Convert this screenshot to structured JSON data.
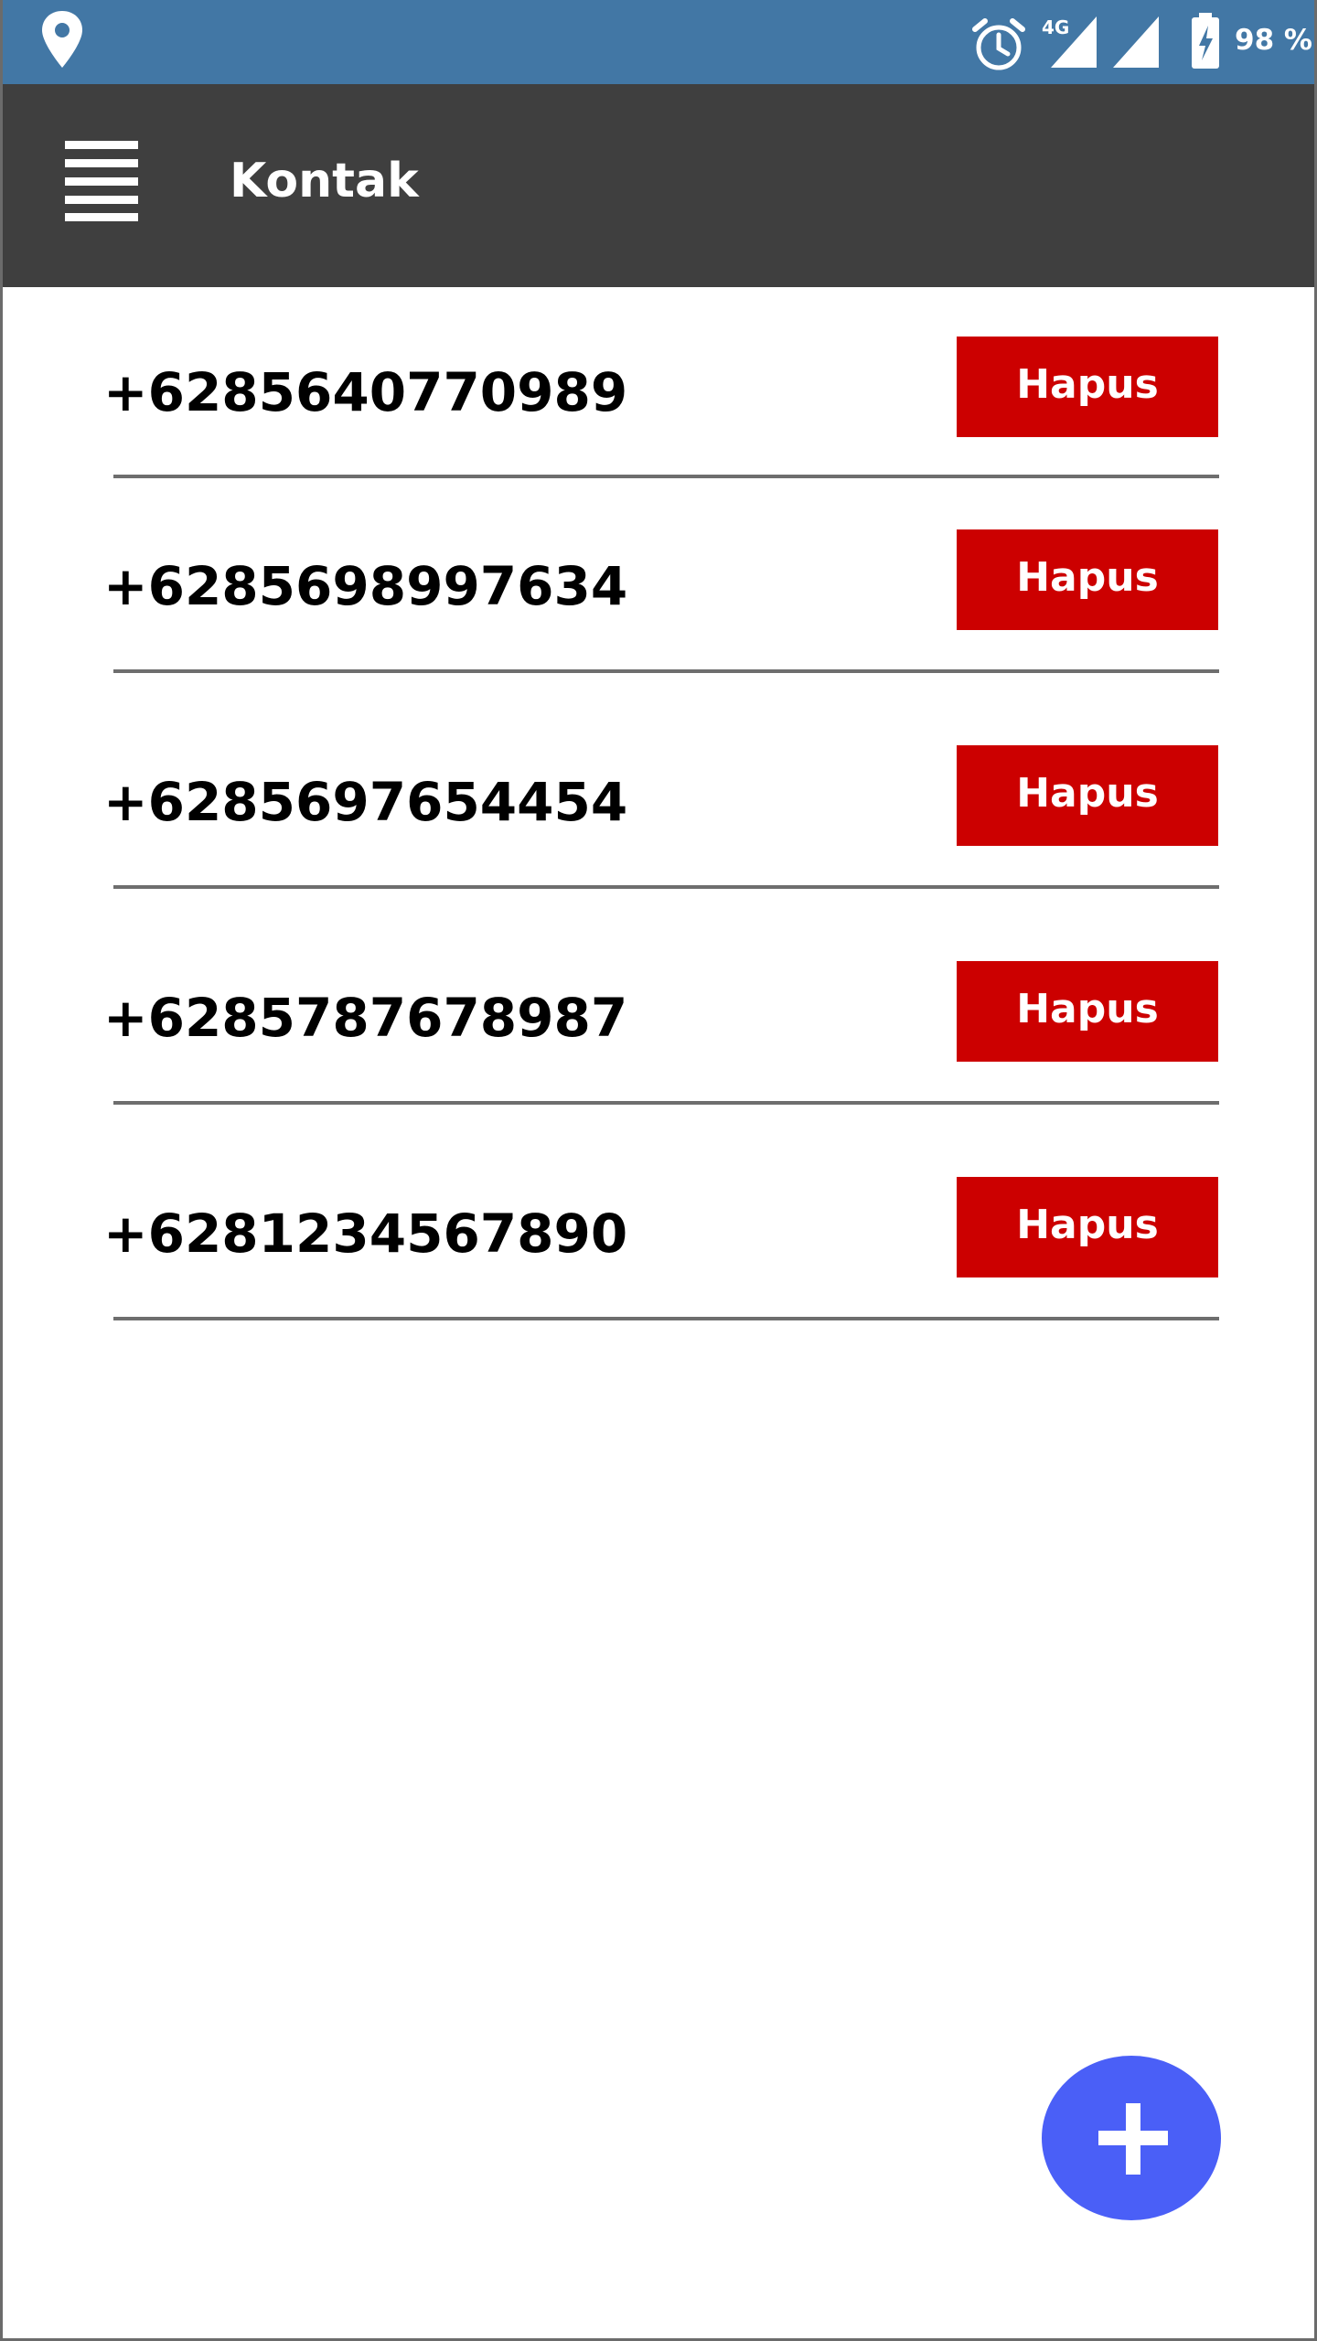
{
  "status_bar": {
    "icons": [
      "location-icon",
      "alarm-icon",
      "signal-icon",
      "signal-icon",
      "battery-charging-icon"
    ],
    "network": "4G",
    "battery": "98 %"
  },
  "app_bar": {
    "menu_icon": "hamburger-menu-icon",
    "title": "Kontak"
  },
  "contacts": [
    {
      "phone": "+6285640770989",
      "delete_label": "Hapus"
    },
    {
      "phone": "+6285698997634",
      "delete_label": "Hapus"
    },
    {
      "phone": "+6285697654454",
      "delete_label": "Hapus"
    },
    {
      "phone": "+6285787678987",
      "delete_label": "Hapus"
    },
    {
      "phone": "+6281234567890",
      "delete_label": "Hapus"
    }
  ],
  "fab": {
    "icon": "plus-icon"
  },
  "colors": {
    "status_bar": "#4277a5",
    "app_bar": "#3f3f3f",
    "delete_button": "#cc0000",
    "fab": "#4a5ff7"
  }
}
